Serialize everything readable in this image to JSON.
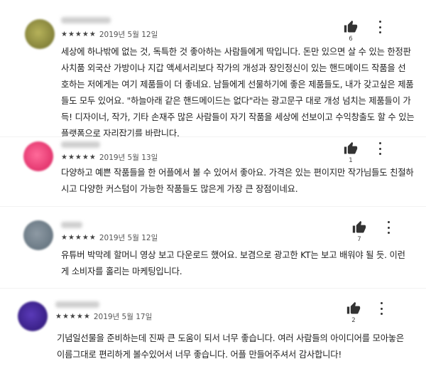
{
  "reviews": [
    {
      "stars": "★★★★★",
      "date": "2019년 5월 12일",
      "likes": "6",
      "avatar_color": "#8a8a3a",
      "lines": [
        "세상에 하나밖에 없는 것, 독특한 것 좋아하는 사람들에게 딱입니다. 돈만 있으면 살 수 있는 한정판",
        "사치품 외국산 가방이나 지갑 액세서리보다 작가의 개성과 장인정신이 있는 핸드메이드 작품을 선",
        "호하는 저에게는 여기 제품들이 더 좋네요. 남들에게 선물하기에 좋은 제품들도, 내가 갖고싶은 제품",
        "들도 모두 있어요. \"하늘아래 같은 핸드메이드는 없다\"라는 광고문구 대로 개성 넘치는 제품들이 가",
        "득! 디자이너, 작가, 기타 손재주 많은 사람들이 자기 작품을 세상에 선보이고 수익창출도 할 수 있는",
        "플랫폼으로 자리잡기를 바랍니다."
      ]
    },
    {
      "stars": "★★★★★",
      "date": "2019년 5월 13일",
      "likes": "1",
      "avatar_color": "#e0356e",
      "lines": [
        "다양하고 예쁜 작품들을 한 어플에서 볼 수 있어서 좋아요. 가격은 있는 편이지만 작가님들도 친절하",
        "시고 다양한 커스텀이 가능한 작품들도 많은게 가장 큰 장점이네요."
      ]
    },
    {
      "stars": "★★★★★",
      "date": "2019년 5월 12일",
      "likes": "7",
      "avatar_color": "#6f7f8c",
      "lines": [
        "유튜버 박막례 할머니 영상 보고 다운로드 했어요. 보겸으로 광고한 KT는 보고 배워야 될 듯. 이런",
        "게 소비자를 홀리는 마케팅입니다."
      ]
    },
    {
      "stars": "★★★★★",
      "date": "2019년 5월 17일",
      "likes": "2",
      "avatar_color": "#3b1f8c",
      "lines": [
        "기념일선물을 준비하는데 진짜 큰 도움이 되서 너무 좋습니다. 여러 사람들의 아이디어를 모아놓은",
        "이름그대로 편리하게 볼수있어서 너무 좋습니다. 어플 만들어주셔서 감사합니다!"
      ]
    }
  ]
}
